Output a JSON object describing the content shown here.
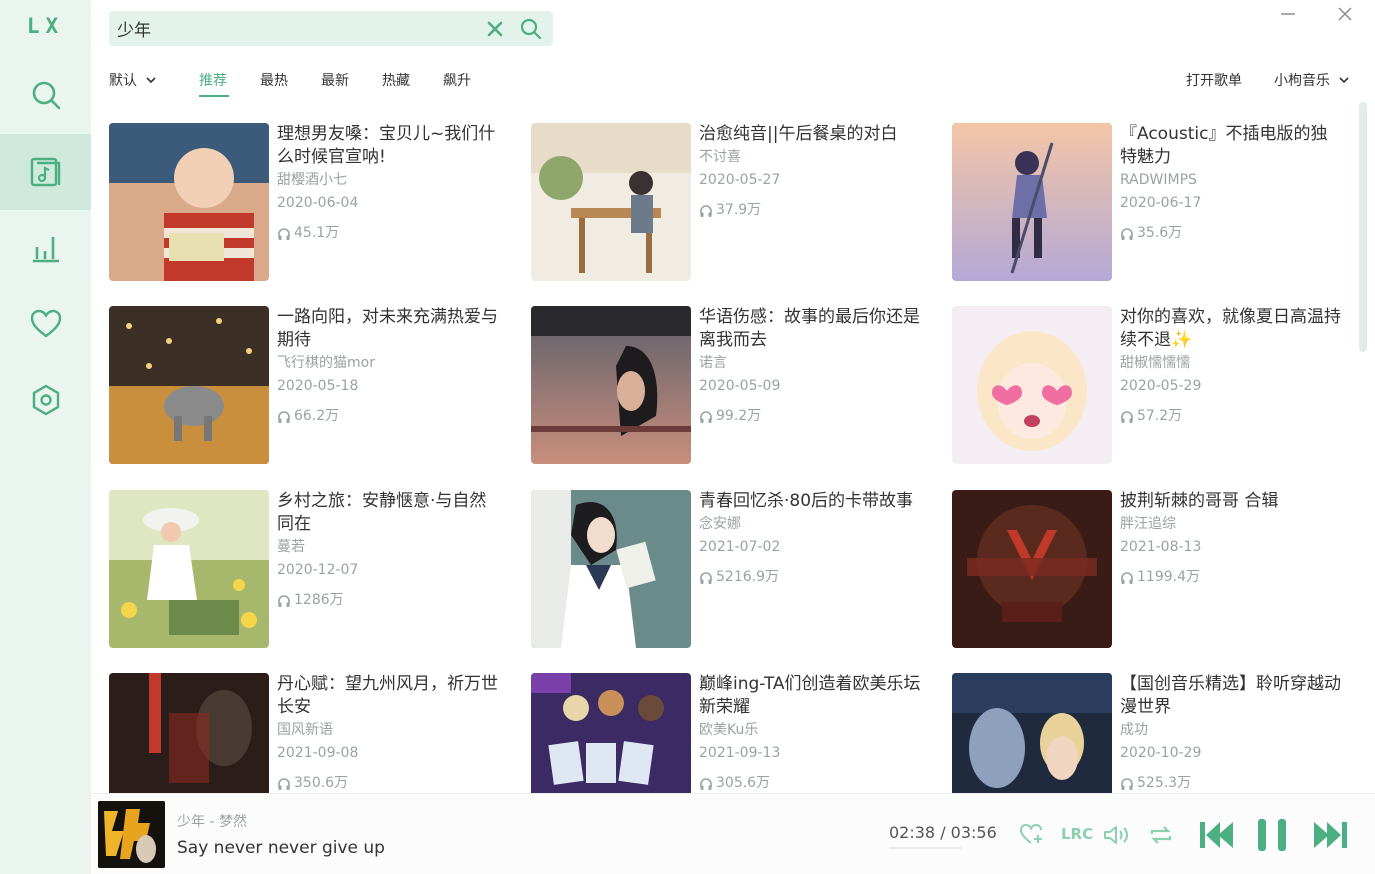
{
  "app": {
    "logo": "LX"
  },
  "colors": {
    "accent": "#4caf82",
    "sidebar_bg": "#eaf5f0",
    "muted": "#9aa3a0"
  },
  "sidebar": {
    "items": [
      {
        "name": "search",
        "icon": "search-icon"
      },
      {
        "name": "song-list",
        "icon": "music-list-icon",
        "active": true
      },
      {
        "name": "leaderboard",
        "icon": "chart-bars-icon"
      },
      {
        "name": "favorites",
        "icon": "heart-icon"
      },
      {
        "name": "settings",
        "icon": "settings-hexagon-icon"
      }
    ]
  },
  "search": {
    "value": "少年",
    "placeholder": ""
  },
  "filters": {
    "sort_label": "默认",
    "tabs": [
      {
        "label": "推荐",
        "active": true
      },
      {
        "label": "最热"
      },
      {
        "label": "最新"
      },
      {
        "label": "热藏"
      },
      {
        "label": "飙升"
      }
    ],
    "open_list": "打开歌单",
    "source": "小枸音乐"
  },
  "playlists": [
    {
      "title": "理想男友嗓：宝贝儿~我们什么时候官宣呐!",
      "author": "甜樱酒小七",
      "date": "2020-06-04",
      "plays": "45.1万"
    },
    {
      "title": "治愈纯音||午后餐桌的对白",
      "author": "不讨喜",
      "date": "2020-05-27",
      "plays": "37.9万"
    },
    {
      "title": "『Acoustic』不插电版的独特魅力",
      "author": "RADWIMPS",
      "date": "2020-06-17",
      "plays": "35.6万"
    },
    {
      "title": "一路向阳，对未来充满热爱与期待",
      "author": "飞行棋的猫mor",
      "date": "2020-05-18",
      "plays": "66.2万"
    },
    {
      "title": "华语伤感：故事的最后你还是离我而去",
      "author": "诺言",
      "date": "2020-05-09",
      "plays": "99.2万"
    },
    {
      "title": "对你的喜欢，就像夏日高温持续不退✨",
      "author": "甜椒懦懦懦",
      "date": "2020-05-29",
      "plays": "57.2万"
    },
    {
      "title": "乡村之旅：安静惬意·与自然同在",
      "author": "蔓若",
      "date": "2020-12-07",
      "plays": "1286万"
    },
    {
      "title": "青春回忆杀·80后的卡带故事",
      "author": "念安娜",
      "date": "2021-07-02",
      "plays": "5216.9万"
    },
    {
      "title": "披荆斩棘的哥哥 合辑",
      "author": "胖汪追综",
      "date": "2021-08-13",
      "plays": "1199.4万"
    },
    {
      "title": "丹心赋：望九州风月，祈万世长安",
      "author": "国风新语",
      "date": "2021-09-08",
      "plays": "350.6万"
    },
    {
      "title": "巅峰ing-TA们创造着欧美乐坛新荣耀",
      "author": "欧美Ku乐",
      "date": "2021-09-13",
      "plays": "305.6万"
    },
    {
      "title": "【国创音乐精选】聆听穿越动漫世界",
      "author": "成功",
      "date": "2020-10-29",
      "plays": "525.3万"
    }
  ],
  "player": {
    "song": "少年 - 梦然",
    "lyric": "Say never never give up",
    "time": "02:38 / 03:56",
    "progress": 0.67,
    "lrc_label": "LRC"
  }
}
